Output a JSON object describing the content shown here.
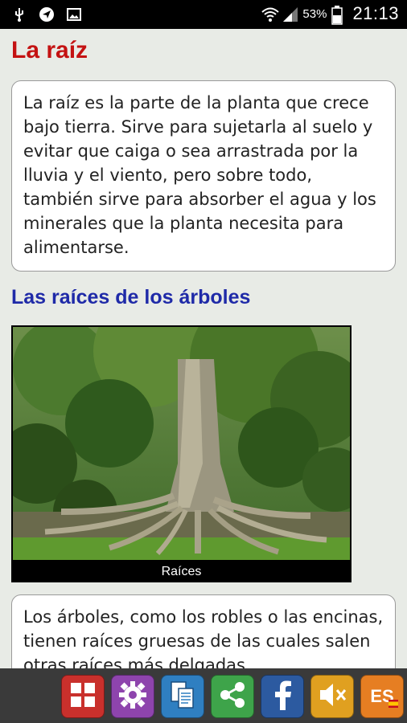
{
  "status_bar": {
    "battery_percent": "53%",
    "time": "21:13",
    "icons": [
      "usb-icon",
      "navigation-icon",
      "image-icon",
      "wifi-icon",
      "signal-icon",
      "battery-icon"
    ]
  },
  "main": {
    "title": "La raíz",
    "intro_text": "La raíz es la parte de la planta que crece bajo tierra. Sirve para sujetarla al suelo y evitar que caiga o sea arrastrada por la lluvia y el viento, pero sobre todo, también sirve para absorber el agua y los minerales que la planta necesita para alimentarse.",
    "section_title": "Las raíces de los árboles",
    "image_caption": "Raíces",
    "section_text": "Los árboles, como los robles o las encinas, tienen raíces gruesas de las cuales salen otras raíces más delgadas"
  },
  "toolbar": {
    "buttons": [
      {
        "name": "menu-grid-button",
        "icon": "grid-icon",
        "color": "#c9302c"
      },
      {
        "name": "settings-button",
        "icon": "gear-icon",
        "color": "#8e44ad"
      },
      {
        "name": "copy-button",
        "icon": "copy-icon",
        "color": "#2f7fc1"
      },
      {
        "name": "share-button",
        "icon": "share-icon",
        "color": "#3ea44a"
      },
      {
        "name": "facebook-button",
        "icon": "facebook-icon",
        "color": "#2c5aa0"
      },
      {
        "name": "mute-button",
        "icon": "speaker-mute-icon",
        "color": "#e0a020"
      },
      {
        "name": "language-button",
        "icon": "spain-flag-icon",
        "label": "ES",
        "color": "#e67e22"
      }
    ]
  }
}
